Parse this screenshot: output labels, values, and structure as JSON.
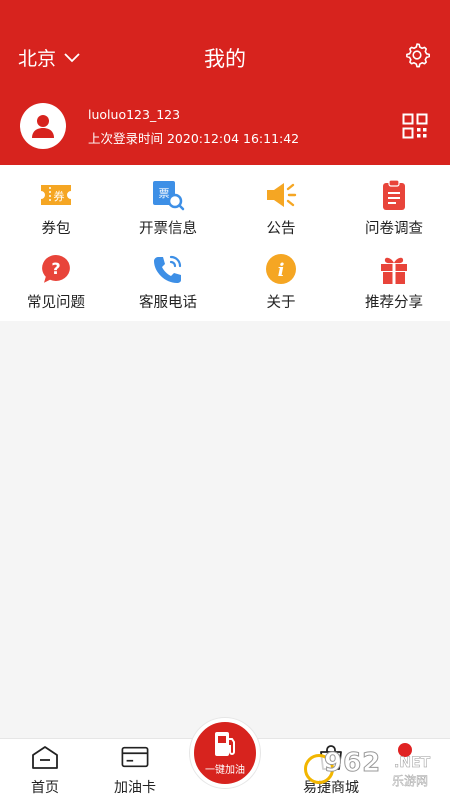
{
  "header": {
    "city": "北京",
    "title": "我的",
    "bg_color": "#d7231e"
  },
  "user": {
    "username": "luoluo123_123",
    "last_login": "上次登录时间 2020:12:04 16:11:42"
  },
  "menu": [
    {
      "label": "券包",
      "icon": "coupon-icon"
    },
    {
      "label": "开票信息",
      "icon": "invoice-search-icon"
    },
    {
      "label": "公告",
      "icon": "megaphone-icon"
    },
    {
      "label": "问卷调查",
      "icon": "clipboard-icon"
    },
    {
      "label": "常见问题",
      "icon": "question-icon"
    },
    {
      "label": "客服电话",
      "icon": "phone-icon"
    },
    {
      "label": "关于",
      "icon": "info-icon"
    },
    {
      "label": "推荐分享",
      "icon": "gift-icon"
    }
  ],
  "coupon_glyph": "券",
  "invoice_glyph": "票",
  "tabbar": {
    "home": "首页",
    "card": "加油卡",
    "refuel": "一键加油",
    "mall": "易捷商城"
  },
  "watermark": {
    "main": "962",
    "net": ".NET",
    "cn": "乐游网"
  }
}
